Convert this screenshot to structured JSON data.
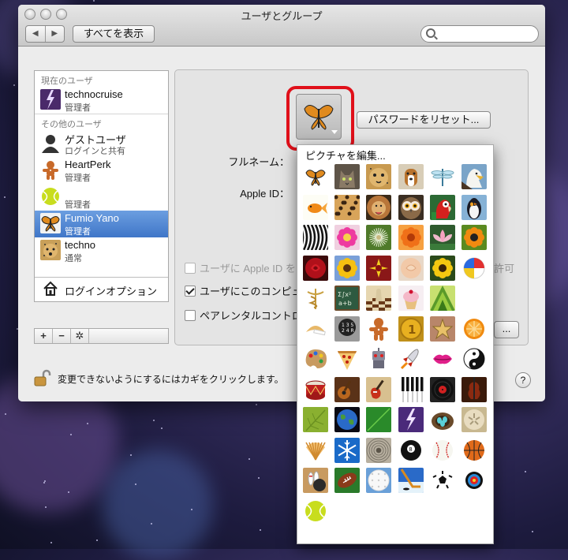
{
  "window": {
    "title": "ユーザとグループ"
  },
  "toolbar": {
    "back": "◀",
    "forward": "▶",
    "show_all": "すべてを表示",
    "search_placeholder": ""
  },
  "sidebar": {
    "current_label": "現在のユーザ",
    "other_label": "その他のユーザ",
    "users": [
      {
        "name": "technocruise",
        "role": "管理者"
      },
      {
        "name": "ゲストユーザ",
        "role": "ログインと共有"
      },
      {
        "name": "HeartPerk",
        "role": "管理者"
      },
      {
        "name": "",
        "role": "管理者"
      },
      {
        "name": "Fumio Yano",
        "role": "管理者"
      },
      {
        "name": "techno",
        "role": "通常"
      }
    ],
    "login_options": "ログインオプション",
    "add": "+",
    "remove": "−",
    "gear": "✲"
  },
  "panel": {
    "reset_password": "パスワードをリセット...",
    "full_name_label": "フルネーム：",
    "apple_id_label": "Apple ID：",
    "check_appleid": "ユーザに Apple ID を",
    "check_appleid_tail": "許可",
    "check_admin": "ユーザにこのコンピュ",
    "check_parental": "ペアレンタルコントロ",
    "more_button": "..."
  },
  "lock_text": "変更できないようにするにはカギをクリックします。",
  "help": "?",
  "picture_menu": {
    "edit": "ピクチャを編集...",
    "pictures": [
      "butterfly",
      "cat",
      "cheetah",
      "dog",
      "dragonfly",
      "eagle",
      "goldfish",
      "leopard-fur",
      "lion",
      "owl",
      "parrot",
      "penguin",
      "zebra",
      "pink-flower",
      "dandelion",
      "orange-flower",
      "lotus",
      "poppy",
      "red-rose",
      "sunflower",
      "yellow-flower",
      "pale-rose",
      "daisy-sunflower",
      "beach-ball",
      "caduceus",
      "chalkboard",
      "chess",
      "cupcake",
      "fruit-slices",
      "empty",
      "fortune-cookie",
      "gear-shift",
      "gingerbread",
      "medal",
      "hollywood-star",
      "orange-slice",
      "paint-palette",
      "pizza",
      "robot",
      "rocket",
      "lips",
      "yin-yang",
      "drum",
      "guitar",
      "electric-guitar",
      "piano",
      "record",
      "violin",
      "leaf",
      "earth",
      "green-leaf",
      "lightning",
      "nest",
      "sand-dollar",
      "shell",
      "snowflake",
      "zen-sand",
      "8-ball",
      "baseball",
      "basketball",
      "bowling",
      "football",
      "golf-ball",
      "hockey",
      "soccer-ball",
      "target",
      "tennis-ball"
    ]
  },
  "colors": {
    "selection": "#3f76c8",
    "highlight_ring": "#e0101a"
  }
}
